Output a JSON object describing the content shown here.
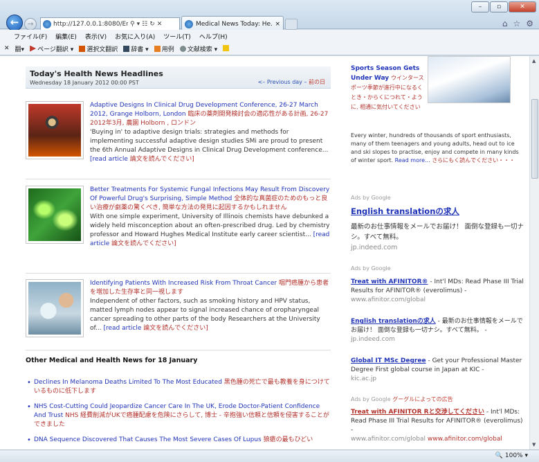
{
  "browser": {
    "url": "http://127.0.0.1:8080/Eng",
    "tab_title": "Medical News Today: He...",
    "window_buttons": [
      "–",
      "▫",
      "✕"
    ],
    "menu": [
      "ファイル(F)",
      "編集(E)",
      "表示(V)",
      "お気に入り(A)",
      "ツール(T)",
      "ヘルプ(H)"
    ],
    "toolbar": [
      "✕",
      "翻▾",
      "ページ翻訳 ▾",
      "選択文翻訳",
      "辞書 ▾",
      "用例",
      "文献検索 ▾"
    ],
    "zoom": "100%"
  },
  "left": {
    "header_title": "Today's Health News Headlines",
    "header_date": "Wednesday 18 January 2012 00:00 PST",
    "prev_day": "<– Previous day –",
    "prev_day_jp": "前の日",
    "articles": [
      {
        "title": "Adaptive Designs In Clinical Drug Development Conference, 26-27 March 2012, Grange Holborn, London",
        "title_jp": "臨床の薬剤開発検討会の適応性がある計画, 26-27 2012年3月, 農園 Holborn , ロンドン",
        "body": "'Buying in' to adaptive design trials: strategies and methods for implementing successful adaptive design studies SMi are proud to present the 6th Annual Adaptive Designs in Clinical Drug Development conference...",
        "more": "[read article",
        "more_jp": "論文を読んでください]"
      },
      {
        "title": "Better Treatments For Systemic Fungal Infections May Result From Discovery Of Powerful Drug's Surprising, Simple Method",
        "title_jp": "全体的な真菌症のためのもっと良い治療が劇薬の驚くべき, 簡単な方法の発見に起因するかもしれません",
        "body": "With one simple experiment, University of Illinois chemists have debunked a widely held misconception about an often-prescribed drug. Led by chemistry professor and Howard Hughes Medical Institute early career scientist...",
        "more": "[read article",
        "more_jp": "論文を読んでください]"
      },
      {
        "title": "Identifying Patients With Increased Risk From Throat Cancer",
        "title_jp": "咽門癌腫から患者を増加した生存率と同一視します",
        "body": "Independent of other factors, such as smoking history and HPV status, matted lymph nodes appear to signal increased chance of oropharyngeal cancer spreading to other parts of the body Researchers at the University of...",
        "more": "[read article",
        "more_jp": "論文を読んでください]"
      }
    ],
    "other_heading": "Other Medical and Health News for 18 January",
    "news": [
      {
        "en": "Declines In Melanoma Deaths Limited To The Most Educated",
        "jp": "黒色腫の死亡で最も教養を身につけているものに低下します"
      },
      {
        "en": "NHS Cost-Cutting Could Jeopardize Cancer Care In The UK, Erode Doctor-Patient Confidence And Trust",
        "jp": "NHS 経費削減がUKで癌腫配慮を危険にさらして, 博士 - 辛抱強い信頼と信頼を侵害することができました"
      },
      {
        "en": "DNA Sequence Discovered That Causes The Most Severe Cases Of Lupus",
        "jp": "狼瘡の最もひどい"
      }
    ]
  },
  "right": {
    "sport_top": "Sports Season Gets",
    "sport_title": "Under Way",
    "sport_jp": "ウインタースポーツ季節が進行中になるくとき・からくにつれて・ように, 相通に気付いてください",
    "sport_body": "Every winter, hundreds of thousands of sport enthusiasts, many of them teenagers and young adults, head out to ice and ski slopes to practise, enjoy and compete in many kinds of winter sport.",
    "sport_more": "Read more...",
    "sport_more_jp": "さらにもく読んでください・・・",
    "ad1_label": "Ads by Google",
    "ad1_title": "English translationの求人",
    "ad1_body": "最新のお仕事情報をメールでお届け！ 面倒な登録も一切ナシ。すべて無料。",
    "ad1_url": "jp.indeed.com",
    "ad2_label": "Ads by Google",
    "ads": [
      {
        "title": "Treat with AFINITOR®",
        "body": "- Int'l MDs: Read Phase III Trial Results for AFINITOR® (everolimus) -",
        "url": "www.afinitor.com/global"
      },
      {
        "title": "English translationの求人",
        "body": "- 最新のお仕事情報をメールでお届け！ 面倒な登録も一切ナシ。すべて無料。 -",
        "url": "jp.indeed.com"
      },
      {
        "title": "Global IT MSc Degree",
        "body": "- Get your Professional Master Degree First global course in Japan at KIC -",
        "url": "kic.ac.jp"
      }
    ],
    "ad3_label": "Ads by Google",
    "ad3_label_jp": "グーグルによっての広告",
    "ad3_title": "Treat with AFINITOR Rと交渉してください",
    "ad3_body": "- Int'l MDs: Read Phase III Trial Results for AFINITOR® (everolimus) -",
    "ad3_url": "www.afinitor.com/global",
    "ad3_url2": "www.afinitor.com/global"
  }
}
